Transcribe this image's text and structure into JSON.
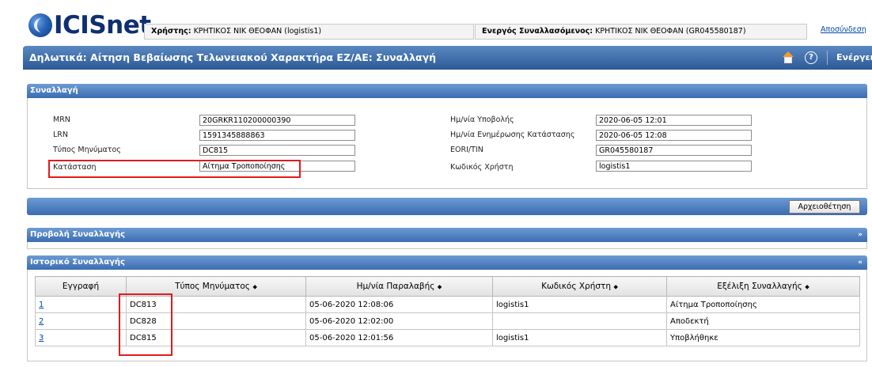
{
  "header": {
    "logo_text": "ICISnet",
    "user_label": "Χρήστης:",
    "user_value": "ΚΡΗΤΙΚΟΣ ΝΙΚ ΘΕΟΦΑΝ (logistis1)",
    "trader_label": "Ενεργός Συναλλασόμενος:",
    "trader_value": "ΚΡΗΤΙΚΟΣ ΝΙΚ ΘΕΟΦΑΝ (GR045580187)",
    "logout": "Αποσύνδεση"
  },
  "titlebar": {
    "title": "Δηλωτικά: Αίτηση Βεβαίωσης Τελωνειακού Χαρακτήρα ΕΖ/ΑΕ: Συναλλαγή",
    "help_glyph": "?",
    "actions": "Ενέργειες"
  },
  "transaction": {
    "section_title": "Συναλλαγή",
    "left": [
      {
        "label": "MRN",
        "value": "20GRKR110200000390"
      },
      {
        "label": "LRN",
        "value": "1591345888863"
      },
      {
        "label": "Τύπος Μηνύματος",
        "value": "DC815"
      },
      {
        "label": "Κατάσταση",
        "value": "Αίτημα Τροποποίησης"
      }
    ],
    "right": [
      {
        "label": "Ημ/νία Υποβολής",
        "value": "2020-06-05 12:01"
      },
      {
        "label": "Ημ/νία Ενημέρωσης Κατάστασης",
        "value": "2020-06-05 12:08"
      },
      {
        "label": "EORI/TIN",
        "value": "GR045580187"
      },
      {
        "label": "Κωδικός Χρήστη",
        "value": "logistis1"
      }
    ]
  },
  "archive_button": "Αρχειοθέτηση",
  "view_section": {
    "title": "Προβολή Συναλλαγής",
    "arrow": "»"
  },
  "history_section": {
    "title": "Ιστορικό Συναλλαγής",
    "arrow": "«",
    "sort_glyph": "⬥",
    "columns": [
      "Εγγραφή",
      "Τύπος Μηνύματος",
      "Ημ/νία Παραλαβής",
      "Κωδικός Χρήστη",
      "Εξέλιξη Συναλλαγής"
    ],
    "rows": [
      {
        "entry": "1",
        "type": "DC813",
        "date": "05-06-2020 12:08:06",
        "user": "logistis1",
        "progress": "Αίτημα Τροποποίησης"
      },
      {
        "entry": "2",
        "type": "DC828",
        "date": "05-06-2020 12:02:00",
        "user": "",
        "progress": "Αποδεκτή"
      },
      {
        "entry": "3",
        "type": "DC815",
        "date": "05-06-2020 12:01:56",
        "user": "logistis1",
        "progress": "Υποβλήθηκε"
      }
    ]
  }
}
